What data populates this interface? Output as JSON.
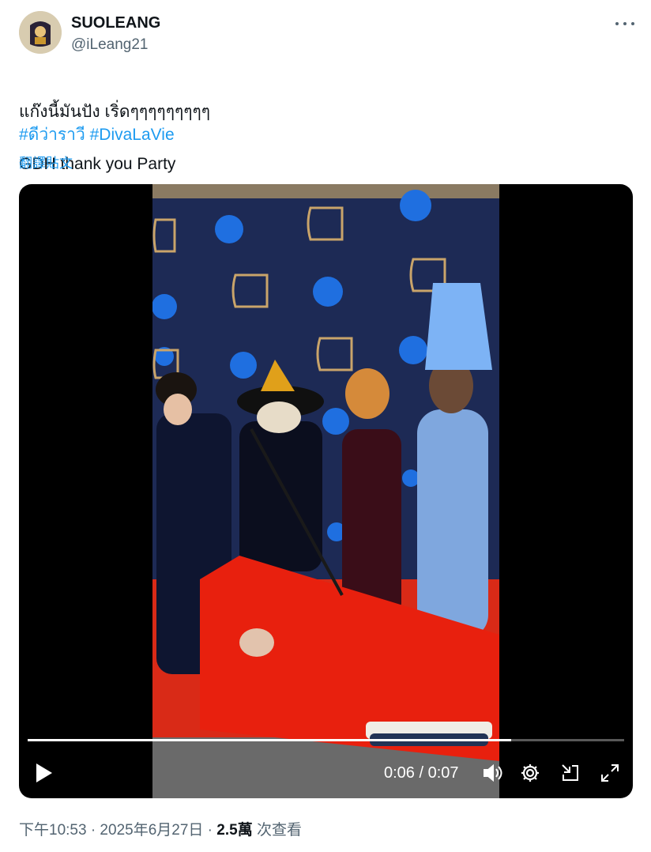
{
  "post": {
    "display_name": "SUOLEANG",
    "handle": "@iLeang21",
    "text_line1": "แก๊งนี้มันปัง เริ่ดๆๆๆๆๆๆๆๆๆ",
    "text_line2": "GDH thank you Party",
    "hashtag1": "#ดีว่าราวี",
    "hashtag2": "#DivaLaVie",
    "translate_label": "翻譯貼文"
  },
  "video": {
    "time_display": "0:06 / 0:07",
    "progress": 0.81
  },
  "footer": {
    "timestamp": "下午10:53 · 2025年6月27日 · ",
    "views_count": "2.5萬",
    "views_label": " 次查看"
  },
  "icons": [
    "more-icon",
    "play-icon",
    "volume-icon",
    "settings-icon",
    "minimize-icon",
    "fullscreen-icon"
  ],
  "colors": {
    "link": "#1d9bf0",
    "secondary": "#536471",
    "text": "#0f1419"
  }
}
